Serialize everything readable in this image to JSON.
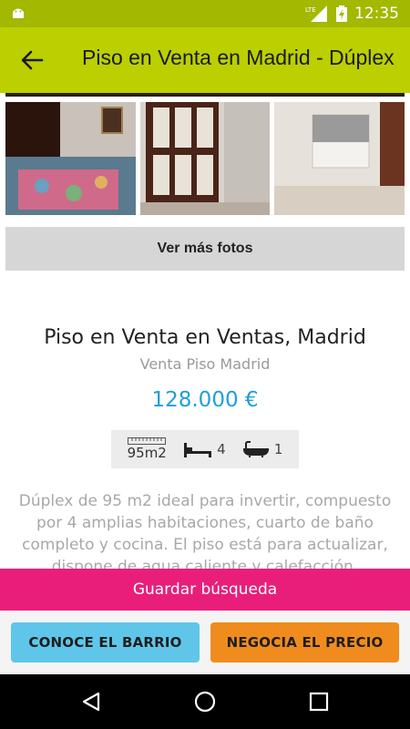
{
  "status_bar": {
    "time": "12:35",
    "network": "LTE"
  },
  "app_bar": {
    "title": "Piso en Venta en Madrid - Dúplex"
  },
  "gallery": {
    "more_photos_label": "Ver más fotos"
  },
  "listing": {
    "title": "Piso en Venta en Ventas, Madrid",
    "subtitle": "Venta Piso Madrid",
    "price": "128.000 €",
    "features": {
      "area": "95m2",
      "bedrooms": "4",
      "bathrooms": "1"
    },
    "description": "Dúplex de 95 m2 ideal para invertir, compuesto por 4 amplias habitaciones, cuarto de baño completo y cocina. El piso está para actualizar, dispone de agua caliente y calefacción."
  },
  "actions": {
    "save_search": "Guardar búsqueda",
    "know_neighborhood": "CONOCE EL BARRIO",
    "negotiate_price": "NEGOCIA EL PRECIO"
  },
  "colors": {
    "app_bar": "#bccf00",
    "status_bar": "#a3b800",
    "price": "#1f9fd8",
    "save_search": "#e91e7b",
    "cta_blue": "#5fc6ea",
    "cta_orange": "#f08c1e"
  }
}
